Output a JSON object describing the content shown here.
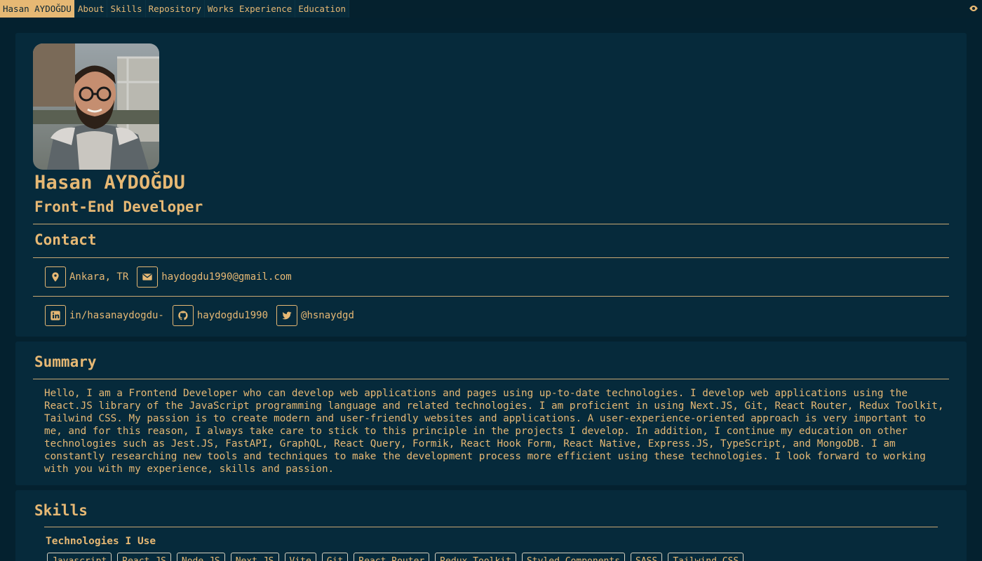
{
  "nav": {
    "items": [
      {
        "label": "Hasan AYDOĞDU",
        "active": true
      },
      {
        "label": "About",
        "active": false
      },
      {
        "label": "Skills",
        "active": false
      },
      {
        "label": "Repository",
        "active": false
      },
      {
        "label": "Works Experience",
        "active": false
      },
      {
        "label": "Education",
        "active": false
      }
    ],
    "visibility_icon": "eye-icon"
  },
  "profile": {
    "name": "Hasan AYDOĞDU",
    "role": "Front-End Developer",
    "photo_icon": "profile-photo"
  },
  "contact": {
    "title": "Contact",
    "location": {
      "icon": "map-pin-icon",
      "label": "Ankara, TR"
    },
    "email": {
      "icon": "envelope-icon",
      "label": "haydogdu1990@gmail.com"
    },
    "linkedin": {
      "icon": "linkedin-icon",
      "label": "in/hasanaydogdu-"
    },
    "github": {
      "icon": "github-icon",
      "label": "haydogdu1990"
    },
    "twitter": {
      "icon": "twitter-icon",
      "label": "@hsnaydgd"
    }
  },
  "summary": {
    "title": "Summary",
    "text": "Hello, I am a Frontend Developer who can develop web applications and pages using up-to-date technologies. I develop web applications using the React.JS library of the JavaScript programming language and related technologies. I am proficient in using Next.JS, Git, React Router, Redux Toolkit, Tailwind CSS. My passion is to create modern and user-friendly websites and applications. A user-experience-oriented approach is very important to me, and for this reason, I always take care to stick to this principle in the projects I develop. In addition, I continue my education on other technologies such as Jest.JS, FastAPI, GraphQL, React Query, Formik, React Hook Form, React Native, Express.JS, TypeScript, and MongoDB. I am constantly researching new tools and techniques to make the development process more efficient using these technologies. I look forward to working with you with my experience, skills and passion."
  },
  "skills": {
    "title": "Skills",
    "subtitle": "Technologies I Use",
    "items": [
      "Javascript",
      "React.JS",
      "Node.JS",
      "Next.JS",
      "Vite",
      "Git",
      "React Router",
      "Redux Toolkit",
      "Styled Components",
      "SASS",
      "Tailwind CSS"
    ]
  },
  "colors": {
    "background": "#04212f",
    "card": "#062a3b",
    "accent": "#e6b874"
  }
}
